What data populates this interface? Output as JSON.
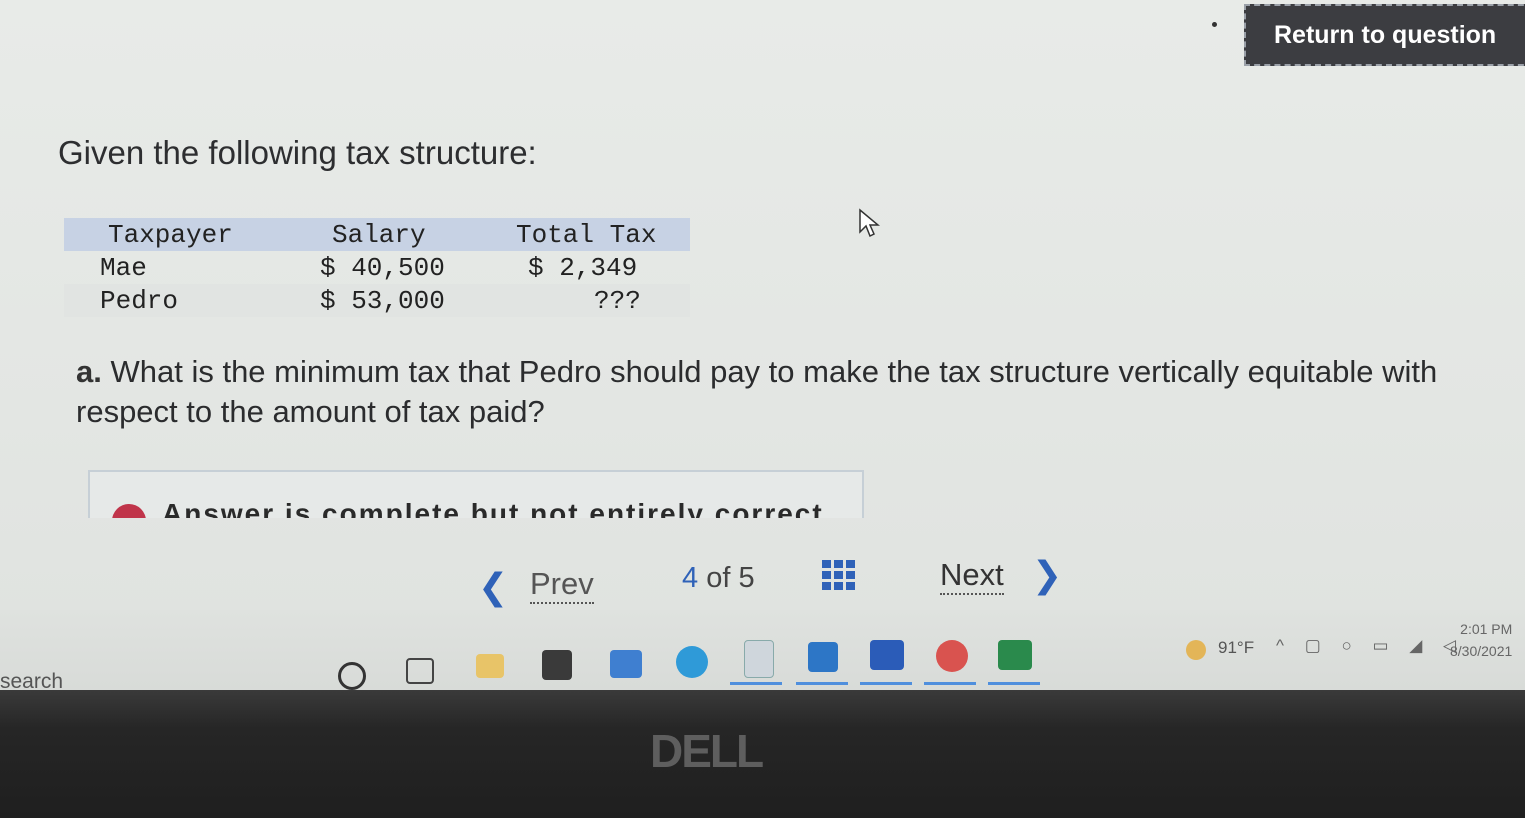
{
  "header": {
    "return_label": "Return to question"
  },
  "intro": "Given the following tax structure:",
  "table": {
    "headers": [
      "Taxpayer",
      "Salary",
      "Total Tax"
    ],
    "rows": [
      [
        "Mae",
        "$ 40,500",
        "$ 2,349"
      ],
      [
        "Pedro",
        "$ 53,000",
        "???"
      ]
    ]
  },
  "question": {
    "prefix": "a.",
    "text": "What is the minimum tax that Pedro should pay to make the tax structure vertically equitable with respect to the amount of tax paid?"
  },
  "answer_banner": "Answer is complete but not entirely correct.",
  "nav": {
    "prev_label": "Prev",
    "current": "4",
    "of_label": "of",
    "total": "5",
    "next_label": "Next"
  },
  "taskbar": {
    "search_label": "search",
    "weather": "91°F",
    "time": "2:01 PM",
    "date": "8/30/2021"
  },
  "brand": "DELL",
  "icons": [
    "cursor-arrow-icon",
    "grid-icon",
    "chevron-left-icon",
    "chevron-right-icon"
  ]
}
